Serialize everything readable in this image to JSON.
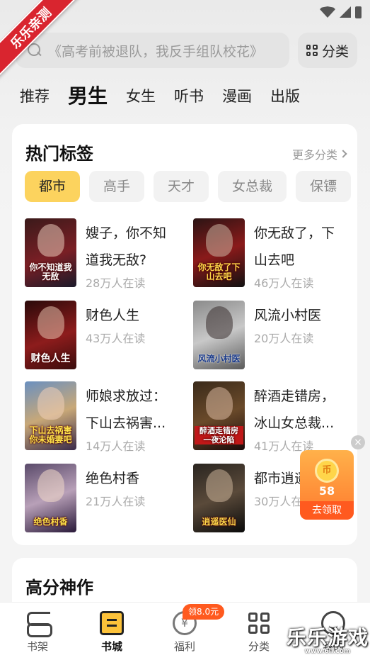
{
  "ribbon": "乐乐亲测",
  "search": {
    "placeholder": "《高考前被退队，我反手组队校花》"
  },
  "category_button": "分类",
  "tabs": [
    "推荐",
    "男生",
    "女生",
    "听书",
    "漫画",
    "出版"
  ],
  "active_tab": "男生",
  "hot_tags": {
    "title": "热门标签",
    "more": "更多分类",
    "chips": [
      "都市",
      "高手",
      "天才",
      "女总裁",
      "保镖",
      ""
    ]
  },
  "books": [
    {
      "name": "嫂子，你不知道我无敌?",
      "readers": "28万人在读",
      "cover_text": "你不知道我无敌"
    },
    {
      "name": "你无敌了，下山去吧",
      "readers": "46万人在读",
      "cover_text": "你无敌了下山去吧"
    },
    {
      "name": "财色人生",
      "readers": "43万人在读",
      "cover_text": "财色人生"
    },
    {
      "name": "风流小村医",
      "readers": "20万人在读",
      "cover_text": "风流小村医"
    },
    {
      "name": "师娘求放过：下山去祸害...",
      "readers": "14万人在读",
      "cover_text": "下山去祸害你未婚妻吧"
    },
    {
      "name": "醉酒走错房，冰山女总裁...",
      "readers": "41万人在读",
      "cover_text": "醉酒走错房 一夜沦陷"
    },
    {
      "name": "绝色村香",
      "readers": "21万人在读",
      "cover_text": "绝色村香"
    },
    {
      "name": "都市逍遥",
      "readers": "30万人在",
      "cover_text": "逍遥医仙"
    }
  ],
  "reward": {
    "coin": "币",
    "amount": "58",
    "action": "去领取",
    "close": "×"
  },
  "section2_title": "高分神作",
  "nav": {
    "items": [
      "书架",
      "书城",
      "福利",
      "分类",
      "我的"
    ],
    "active": "书城",
    "badge": "领8.0元"
  },
  "watermark": {
    "title": "乐乐游戏",
    "url": "www.6ll.com"
  },
  "colors": {
    "accent": "#fcd35e",
    "brand_red": "#d9252f",
    "reward_orange": "#ff7a2e"
  }
}
